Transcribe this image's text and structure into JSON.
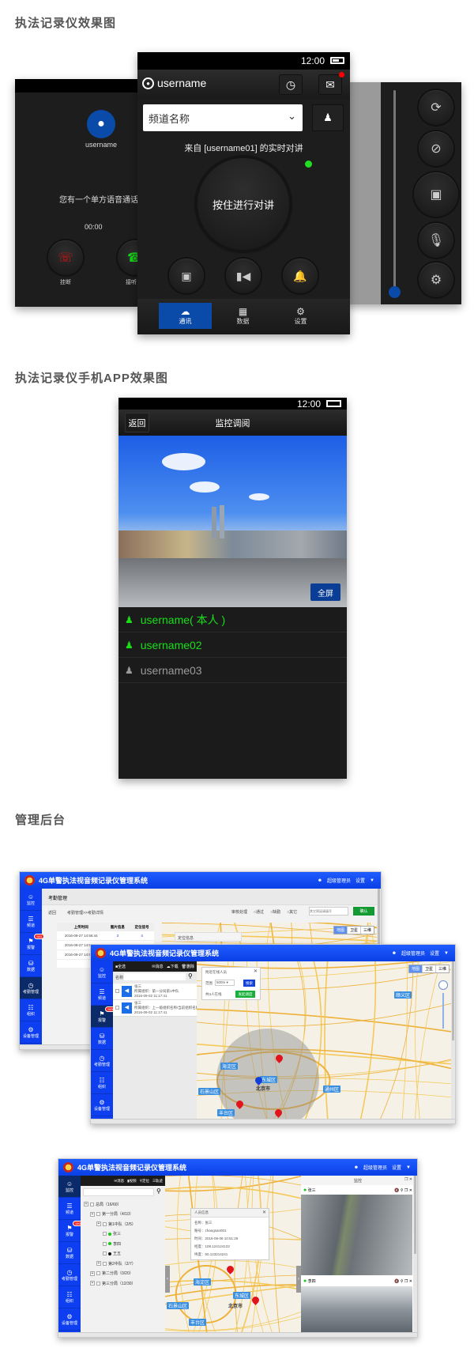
{
  "sections": {
    "device_title": "执法记录仪效果图",
    "app_title": "执法记录仪手机APP效果图",
    "admin_title": "管理后台"
  },
  "device_call": {
    "caller": "username",
    "message": "您有一个单方语音通话",
    "timer": "00:00",
    "hangup_label": "挂断",
    "answer_label": "接听"
  },
  "device_main": {
    "time": "12:00",
    "username": "username",
    "channel_placeholder": "频道名称",
    "talk_status": "来自 [username01] 的实时对讲",
    "talk_button": "按住进行对讲",
    "tabs": [
      {
        "label": "通讯",
        "icon": "cloud-icon",
        "active": true
      },
      {
        "label": "数据",
        "icon": "grid-icon",
        "active": false
      },
      {
        "label": "设置",
        "icon": "gear-icon",
        "active": false
      }
    ],
    "status_dot_color": "#22dd22",
    "accent": "#0a4aa8"
  },
  "device_side": {
    "buttons": [
      "camera-switch-icon",
      "flash-off-icon",
      "camera-icon",
      "mic-off-icon",
      "gear-icon"
    ],
    "slider_level": 0
  },
  "app": {
    "time": "12:00",
    "back_label": "返回",
    "title": "监控调阅",
    "fullscreen_label": "全屏",
    "users": [
      {
        "name": "username( 本人 )",
        "online": true
      },
      {
        "name": "username02",
        "online": true
      },
      {
        "name": "username03",
        "online": false
      }
    ],
    "online_color": "#18e018",
    "offline_color": "#9a9a9a"
  },
  "admin": {
    "system_title": "4G单警执法视音频记录仪管理系统",
    "user_label": "超级管理员",
    "settings_label": "设置",
    "sidebar": [
      "监控",
      "频道",
      "报警",
      "数据",
      "考勤管理",
      "组织",
      "设备管理"
    ],
    "alarm_badge": "583",
    "map_types": [
      "地图",
      "卫星",
      "三维"
    ],
    "attendance": {
      "page_title": "考勤管理",
      "back": "返回",
      "breadcrumb": "考勤管理>>考勤详情",
      "filter_label": "审核处理",
      "options": [
        "通过",
        "缺勤",
        "其它"
      ],
      "reason_placeholder": "其它原因请填写",
      "confirm": "确认",
      "columns": [
        "上传时间",
        "图片信息",
        "定位信号"
      ],
      "rows": [
        [
          "2016-09-27 14:56:44",
          "3",
          "4"
        ],
        [
          "2016-09-27 14:56:44",
          "",
          ""
        ],
        [
          "2016-09-27 14:56:44",
          "",
          ""
        ]
      ],
      "more": "……",
      "map_popup_title": "定位信息"
    },
    "alarm": {
      "select_all": "全选",
      "toolbar": [
        "消息",
        "下载",
        "删除"
      ],
      "search_label": "名称",
      "items": [
        {
          "name": "张三",
          "org": "所属组织：第一分局第1中队",
          "time": "2016-09-02 11:17:41"
        },
        {
          "name": "张三",
          "org": "所属组织：上一级组织名称/当前组织名称",
          "time": "2016-09-02 11:17:41"
        }
      ],
      "popup_title": "附近在线人员",
      "range_label": "范围",
      "range_value": "500m",
      "search_btn": "搜索",
      "online_count": "共3人在线",
      "dispatch_btn": "发起调度",
      "map_labels": [
        "顺义区",
        "海淀区",
        "东城区",
        "北京市",
        "石景山区",
        "丰台区",
        "通州区"
      ]
    },
    "monitor": {
      "toolbar": [
        "消息",
        "视频",
        "定位",
        "轨迹"
      ],
      "tree": [
        {
          "label": "总局（16/60）",
          "level": 0
        },
        {
          "label": "第一分局（4/10）",
          "level": 1
        },
        {
          "label": "第1中队（2/5）",
          "level": 2
        },
        {
          "label": "张三",
          "level": 3,
          "status": "online"
        },
        {
          "label": "李四",
          "level": 3,
          "status": "online"
        },
        {
          "label": "王五",
          "level": 3,
          "status": "offline"
        },
        {
          "label": "第2中队（2/7）",
          "level": 2
        },
        {
          "label": "第二分局（0/20）",
          "level": 1
        },
        {
          "label": "第三分局（12/30）",
          "level": 1
        }
      ],
      "popup_title": "人员信息",
      "popup_lines": [
        "名称：张三",
        "账号：zhangsan001",
        "时间：2016-09-08 10:51:29",
        "经度：108.124124123",
        "纬度：50.123214241"
      ],
      "map_labels": [
        "海淀区",
        "东城区",
        "北京市",
        "石景山区",
        "丰台区"
      ],
      "panel_title": "监控",
      "videos": [
        "张三",
        "李四"
      ]
    }
  }
}
